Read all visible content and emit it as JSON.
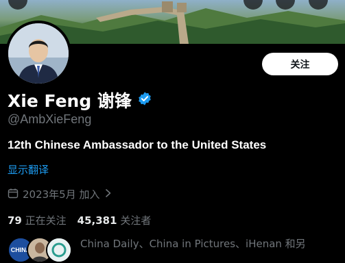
{
  "profile": {
    "name": "Xie Feng 谢锋",
    "handle": "@AmbXieFeng",
    "bio": "12th Chinese Ambassador to the United States",
    "translate_label": "显示翻译",
    "joined": "2023年5月 加入",
    "following_count": "79",
    "following_label": "正在关注",
    "followers_count": "45,381",
    "followers_label": "关注者",
    "followed_by": "China Daily、China in Pictures、iHenan 和另",
    "mini_avatar_text": "CHINA"
  },
  "actions": {
    "follow_label": "关注"
  },
  "icons": {
    "verified": "verified-badge-icon",
    "calendar": "calendar-icon",
    "chevron": "chevron-right-icon"
  },
  "colors": {
    "background": "#000000",
    "accent": "#1d9bf0",
    "muted": "#71767b",
    "text": "#e7e9ea"
  }
}
